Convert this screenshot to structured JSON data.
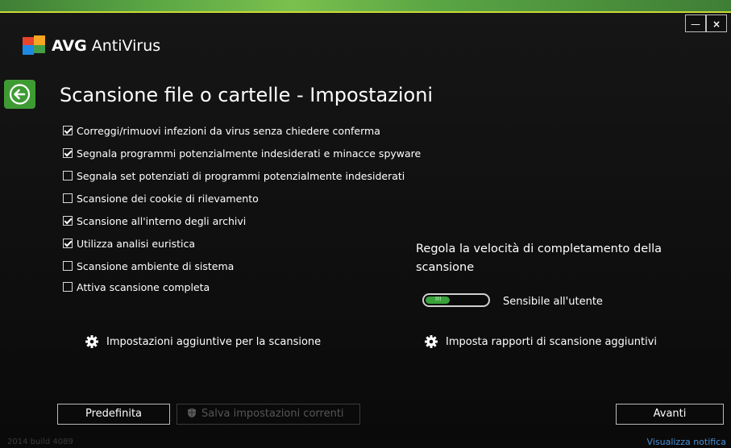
{
  "window": {
    "brand_prefix": "AVG",
    "brand_suffix": " AntiVirus",
    "minimize_label": "—",
    "close_label": "×"
  },
  "page": {
    "title": "Scansione file o cartelle - Impostazioni"
  },
  "options": [
    {
      "label": "Correggi/rimuovi infezioni da virus senza chiedere conferma",
      "checked": true
    },
    {
      "label": "Segnala programmi potenzialmente indesiderati e minacce spyware",
      "checked": true
    },
    {
      "label": "Segnala set potenziati di programmi potenzialmente indesiderati",
      "checked": false
    },
    {
      "label": "Scansione dei cookie di rilevamento",
      "checked": false
    },
    {
      "label": "Scansione all'interno degli archivi",
      "checked": true
    },
    {
      "label": "Utilizza analisi euristica",
      "checked": true
    },
    {
      "label": "Scansione ambiente di sistema",
      "checked": false
    },
    {
      "label": "Attiva scansione completa",
      "checked": false
    }
  ],
  "speed": {
    "title": "Regola la velocità di completamento della scansione",
    "grip": "III",
    "value_label": "Sensibile all'utente",
    "level": 0.4
  },
  "links": {
    "scan_settings": "Impostazioni aggiuntive per la scansione",
    "report_settings": "Imposta rapporti di scansione aggiuntivi"
  },
  "buttons": {
    "default": "Predefinita",
    "save": "Salva impostazioni correnti",
    "next": "Avanti"
  },
  "footer": {
    "version": "2014  build 4089",
    "notification": "Visualizza notifica"
  },
  "colors": {
    "accent_green": "#3e9b33",
    "link_blue": "#4a8fd6"
  }
}
